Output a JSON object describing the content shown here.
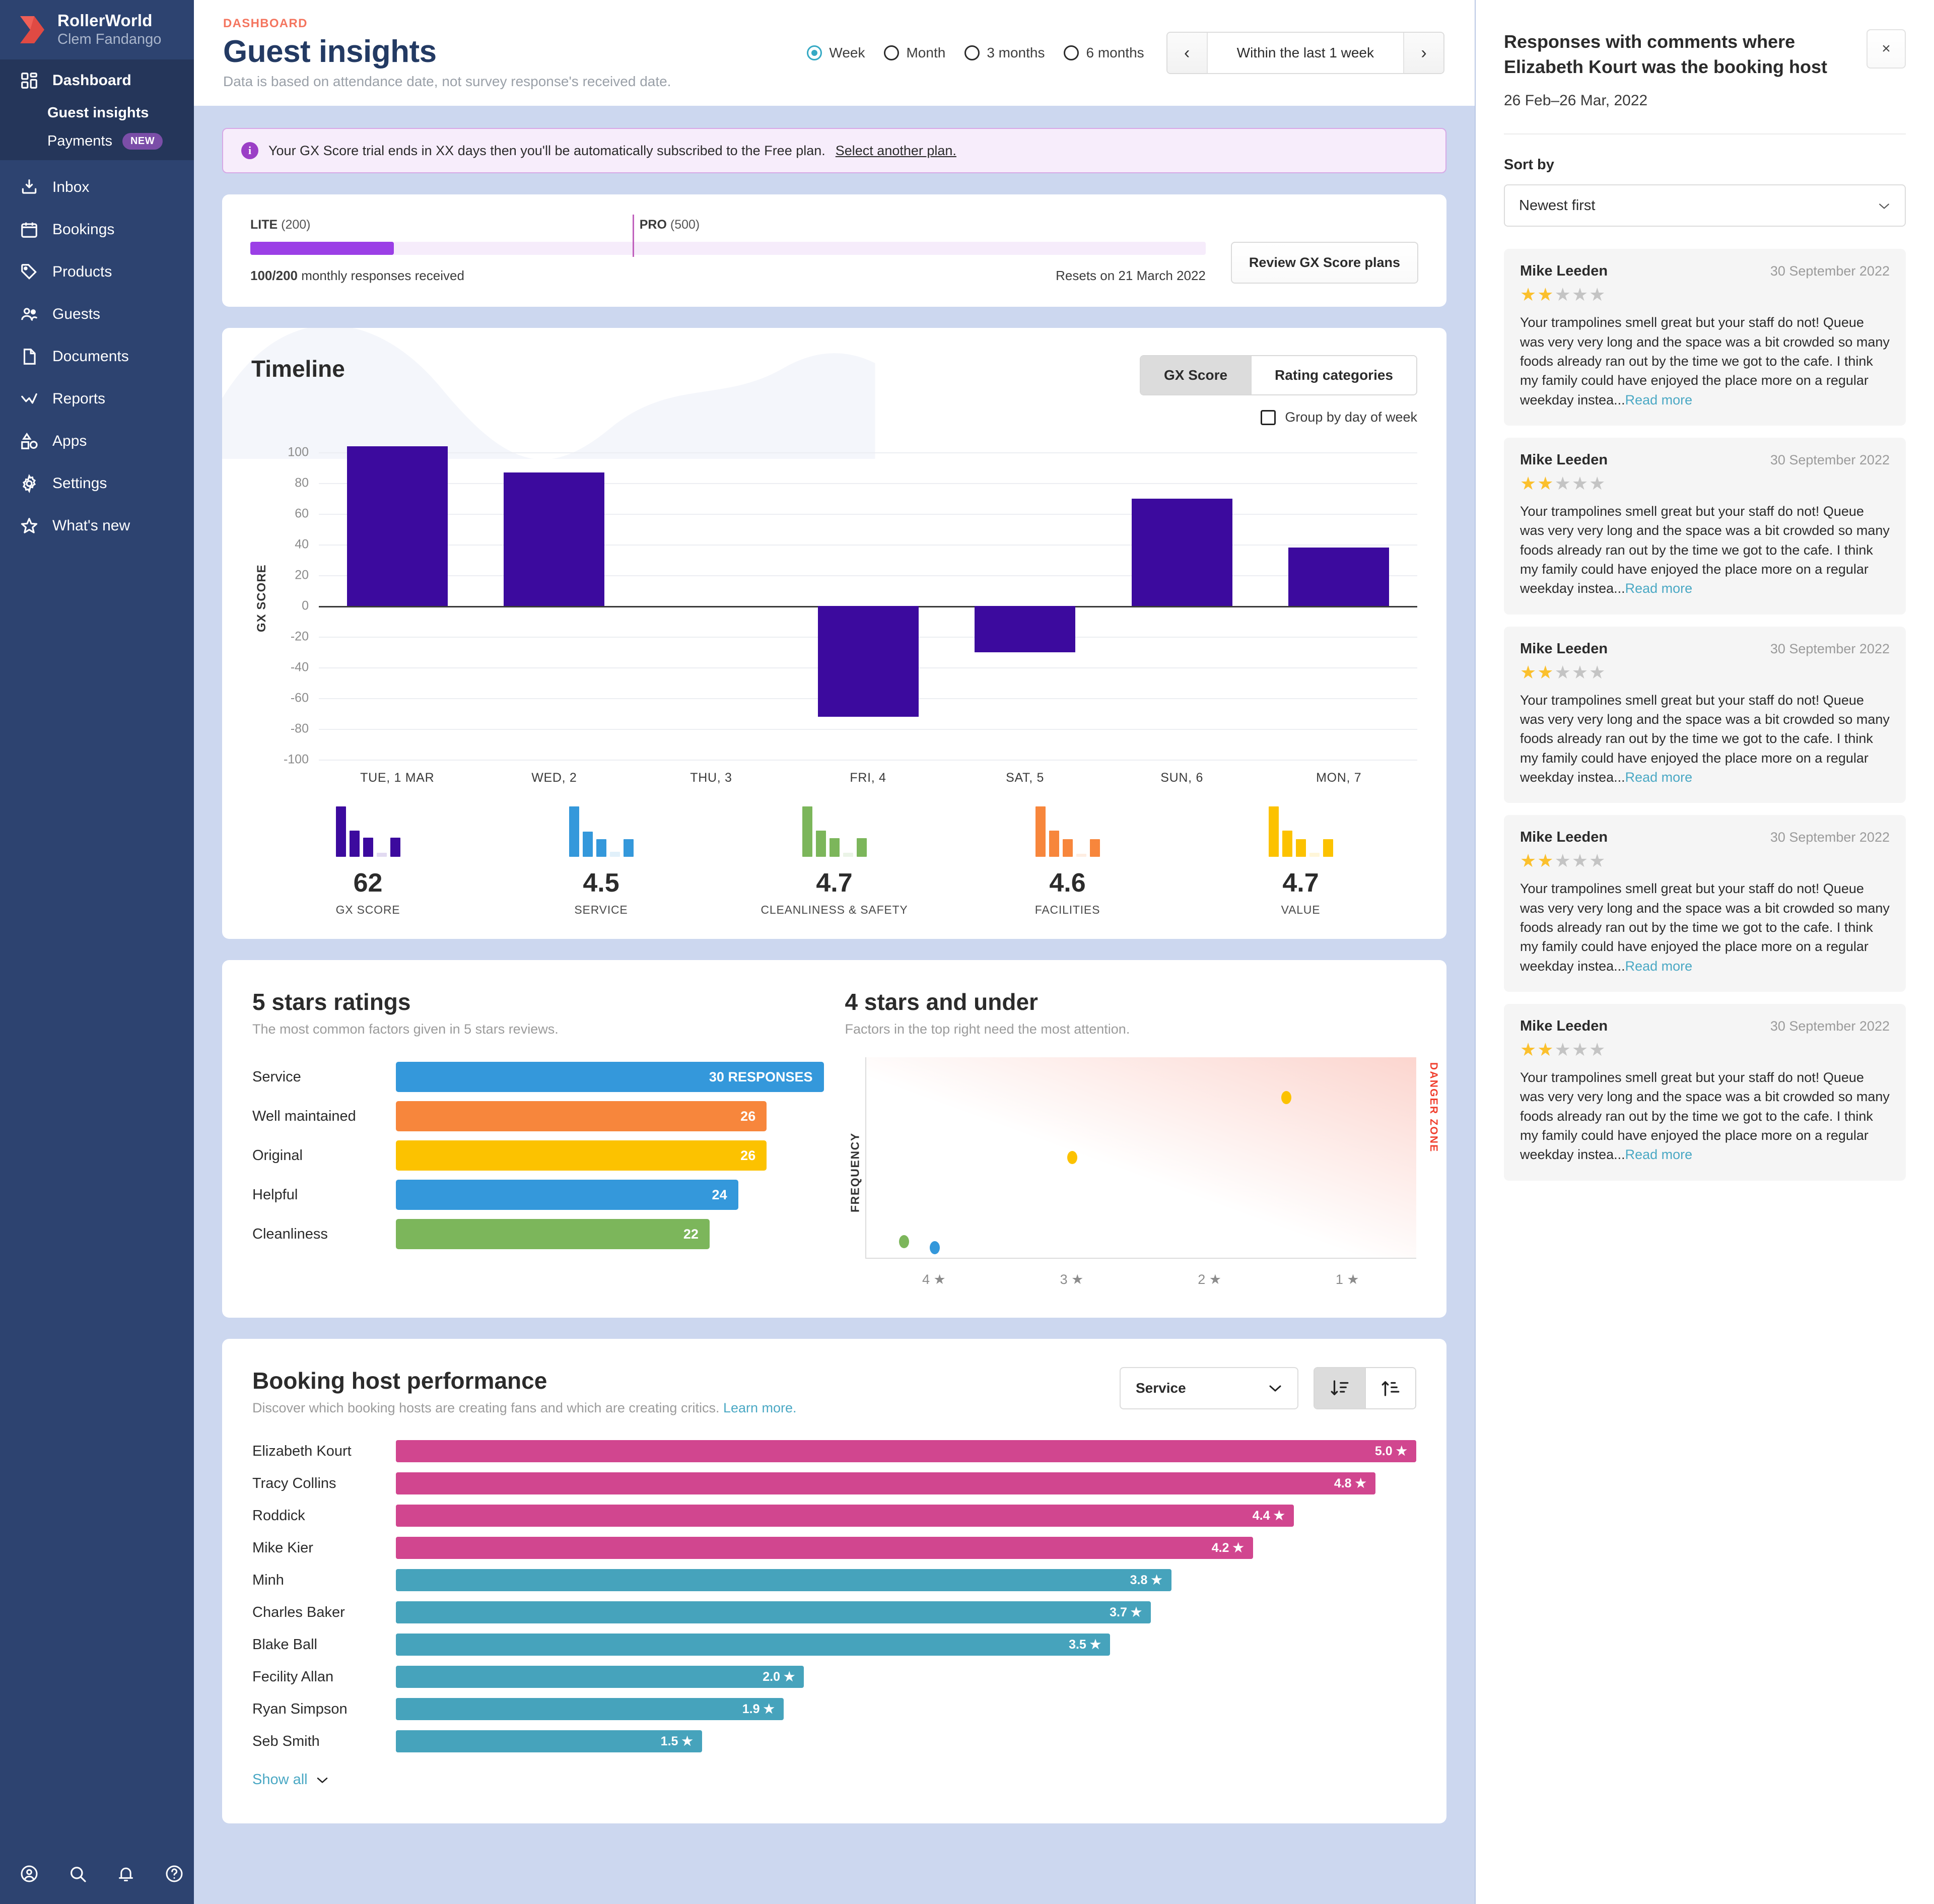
{
  "brand": {
    "name": "RollerWorld",
    "user": "Clem Fandango"
  },
  "sidebar": {
    "primary": [
      {
        "label": "Dashboard",
        "icon": "grid-icon"
      }
    ],
    "sub": [
      {
        "label": "Guest insights",
        "current": true
      },
      {
        "label": "Payments",
        "badge": "NEW"
      }
    ],
    "items": [
      {
        "label": "Inbox",
        "icon": "inbox-icon"
      },
      {
        "label": "Bookings",
        "icon": "calendar-icon"
      },
      {
        "label": "Products",
        "icon": "tag-icon"
      },
      {
        "label": "Guests",
        "icon": "people-icon"
      },
      {
        "label": "Documents",
        "icon": "document-icon"
      },
      {
        "label": "Reports",
        "icon": "chart-line-icon"
      },
      {
        "label": "Apps",
        "icon": "apps-icon"
      },
      {
        "label": "Settings",
        "icon": "gear-icon"
      },
      {
        "label": "What's new",
        "icon": "star-icon"
      }
    ],
    "footer_icons": [
      "account-icon",
      "search-icon",
      "bell-icon",
      "help-icon"
    ]
  },
  "header": {
    "eyebrow": "DASHBOARD",
    "title": "Guest insights",
    "subtitle": "Data is based on attendance date, not survey response's received date.",
    "range_options": [
      {
        "label": "Week",
        "selected": true
      },
      {
        "label": "Month",
        "selected": false
      },
      {
        "label": "3 months",
        "selected": false
      },
      {
        "label": "6 months",
        "selected": false
      }
    ],
    "date_nav": {
      "prev": "‹",
      "value": "Within the last 1 week",
      "next": "›"
    }
  },
  "alert": {
    "icon": "info-icon",
    "text": "Your GX Score trial ends in XX days then you'll be automatically subscribed to the Free plan.",
    "link": "Select another plan."
  },
  "plan": {
    "lite_label": "LITE",
    "lite_value": "(200)",
    "pro_label": "PRO",
    "pro_value": "(500)",
    "progress_pct": 15,
    "marker_pct": 40,
    "responses": "100/200",
    "responses_suffix": " monthly responses received",
    "resets": "Resets on 21 March 2022",
    "review_button": "Review GX Score plans"
  },
  "timeline": {
    "title": "Timeline",
    "tabs": [
      {
        "label": "GX Score",
        "selected": true
      },
      {
        "label": "Rating categories",
        "selected": false
      }
    ],
    "group_by": {
      "label": "Group by day of week",
      "checked": false
    },
    "stats": [
      {
        "value": "62",
        "label": "GX SCORE",
        "color": "#3c0a9e",
        "spark": [
          100,
          52,
          38,
          8,
          38
        ]
      },
      {
        "value": "4.5",
        "label": "SERVICE",
        "color": "#3498db",
        "spark": [
          100,
          50,
          35,
          10,
          35
        ]
      },
      {
        "value": "4.7",
        "label": "CLEANLINESS & SAFETY",
        "color": "#7cb65b",
        "spark": [
          100,
          52,
          37,
          8,
          37
        ]
      },
      {
        "value": "4.6",
        "label": "FACILITIES",
        "color": "#f7863c",
        "spark": [
          100,
          52,
          35,
          6,
          35
        ]
      },
      {
        "value": "4.7",
        "label": "VALUE",
        "color": "#fcc200",
        "spark": [
          100,
          52,
          35,
          8,
          35
        ]
      }
    ]
  },
  "chart_data": [
    {
      "type": "bar",
      "title": "Timeline",
      "xlabel": "",
      "ylabel": "GX SCORE",
      "ylim": [
        -100,
        110
      ],
      "yticks": [
        100,
        80,
        60,
        40,
        20,
        0,
        -20,
        -40,
        -60,
        -80,
        -100
      ],
      "grid": true,
      "bar_color": "#3c0a9e",
      "categories": [
        "TUE, 1 MAR",
        "WED, 2",
        "THU, 3",
        "FRI, 4",
        "SAT, 5",
        "SUN, 6",
        "MON, 7"
      ],
      "values": [
        104,
        87,
        0,
        -72,
        -30,
        70,
        38
      ]
    },
    {
      "type": "bar",
      "title": "5 stars ratings",
      "subtitle": "The most common factors given in 5 stars reviews.",
      "orientation": "horizontal",
      "xlabel": "",
      "ylabel": "",
      "categories": [
        "Service",
        "Well maintained",
        "Original",
        "Helpful",
        "Cleanliness"
      ],
      "values": [
        30,
        26,
        26,
        24,
        22
      ],
      "value_labels": [
        "30 RESPONSES",
        "26",
        "26",
        "24",
        "22"
      ],
      "colors": [
        "#3498db",
        "#f7863c",
        "#fcc200",
        "#3498db",
        "#7cb65b"
      ]
    },
    {
      "type": "scatter",
      "title": "4 stars and under",
      "subtitle": "Factors in the top right need the most attention.",
      "xlabel": "",
      "ylabel": "FREQUENCY",
      "xtick_labels": [
        "4 ★",
        "3 ★",
        "2 ★",
        "1 ★"
      ],
      "annotation": "DANGER ZONE",
      "points": [
        {
          "x": 4.0,
          "y": 0.08,
          "color": "#7cb65b"
        },
        {
          "x": 3.8,
          "y": 0.05,
          "color": "#3498db"
        },
        {
          "x": 2.9,
          "y": 0.5,
          "color": "#fcc200"
        },
        {
          "x": 1.5,
          "y": 0.8,
          "color": "#fcc200"
        }
      ]
    },
    {
      "type": "bar",
      "title": "Booking host performance",
      "subtitle": "Discover which booking hosts are creating fans and which are creating critics.",
      "orientation": "horizontal",
      "xlabel": "",
      "ylabel": "",
      "xlim": [
        0,
        5
      ],
      "categories": [
        "Elizabeth Kourt",
        "Tracy Collins",
        "Roddick",
        "Mike Kier",
        "Minh",
        "Charles Baker",
        "Blake Ball",
        "Fecility Allan",
        "Ryan Simpson",
        "Seb Smith"
      ],
      "values": [
        5.0,
        4.8,
        4.4,
        4.2,
        3.8,
        3.7,
        3.5,
        2.0,
        1.9,
        1.5
      ],
      "value_labels": [
        "5.0 ★",
        "4.8 ★",
        "4.4 ★",
        "4.2 ★",
        "3.8 ★",
        "3.7 ★",
        "3.5 ★",
        "2.0 ★",
        "1.9 ★",
        "1.5 ★"
      ],
      "colors": [
        "#d1468f",
        "#d1468f",
        "#d1468f",
        "#d1468f",
        "#46a3bc",
        "#46a3bc",
        "#46a3bc",
        "#46a3bc",
        "#46a3bc",
        "#46a3bc"
      ]
    }
  ],
  "five_star": {
    "title": "5 stars ratings",
    "subtitle": "The most common factors given in 5 stars reviews.",
    "rows": [
      {
        "label": "Service",
        "value": 30,
        "display": "30 RESPONSES",
        "color": "#3498db"
      },
      {
        "label": "Well maintained",
        "value": 26,
        "display": "26",
        "color": "#f7863c"
      },
      {
        "label": "Original",
        "value": 26,
        "display": "26",
        "color": "#fcc200"
      },
      {
        "label": "Helpful",
        "value": 24,
        "display": "24",
        "color": "#3498db"
      },
      {
        "label": "Cleanliness",
        "value": 22,
        "display": "22",
        "color": "#7cb65b"
      }
    ]
  },
  "four_star": {
    "title": "4 stars and under",
    "subtitle": "Factors in the top right need the most attention.",
    "ylabel": "FREQUENCY",
    "danger": "DANGER ZONE",
    "xticks": [
      "4 ★",
      "3 ★",
      "2 ★",
      "1 ★"
    ]
  },
  "hosts": {
    "title": "Booking host performance",
    "subtitle": "Discover which booking hosts are creating fans and which are creating critics.",
    "link": "Learn more.",
    "filter": "Service",
    "chevron": "⌄",
    "sort_desc_icon": "sort-descending-icon",
    "sort_asc_icon": "sort-ascending-icon",
    "show_all": "Show all",
    "rows": [
      {
        "name": "Elizabeth Kourt",
        "value": 5.0,
        "display": "5.0 ★",
        "color": "#d1468f"
      },
      {
        "name": "Tracy Collins",
        "value": 4.8,
        "display": "4.8 ★",
        "color": "#d1468f"
      },
      {
        "name": "Roddick",
        "value": 4.4,
        "display": "4.4 ★",
        "color": "#d1468f"
      },
      {
        "name": "Mike Kier",
        "value": 4.2,
        "display": "4.2 ★",
        "color": "#d1468f"
      },
      {
        "name": "Minh",
        "value": 3.8,
        "display": "3.8 ★",
        "color": "#46a3bc"
      },
      {
        "name": "Charles Baker",
        "value": 3.7,
        "display": "3.7 ★",
        "color": "#46a3bc"
      },
      {
        "name": "Blake Ball",
        "value": 3.5,
        "display": "3.5 ★",
        "color": "#46a3bc"
      },
      {
        "name": "Fecility Allan",
        "value": 2.0,
        "display": "2.0 ★",
        "color": "#46a3bc"
      },
      {
        "name": "Ryan Simpson",
        "value": 1.9,
        "display": "1.9 ★",
        "color": "#46a3bc"
      },
      {
        "name": "Seb Smith",
        "value": 1.5,
        "display": "1.5 ★",
        "color": "#46a3bc"
      }
    ]
  },
  "panel": {
    "title": "Responses with comments where Elizabeth Kourt was the booking host",
    "close": "×",
    "date_range": "26 Feb–26 Mar, 2022",
    "sort_label": "Sort by",
    "sort_value": "Newest first",
    "responses": [
      {
        "name": "Mike Leeden",
        "date": "30 September 2022",
        "rating": 2,
        "text": "Your trampolines smell great but your staff do not! Queue was very very long and the space was a bit crowded so many foods already ran out by the time we got to the cafe. I think my family could have enjoyed the place more on a regular weekday instea...",
        "more": "Read more"
      },
      {
        "name": "Mike Leeden",
        "date": "30 September 2022",
        "rating": 2,
        "text": "Your trampolines smell great but your staff do not! Queue was very very long and the space was a bit crowded so many foods already ran out by the time we got to the cafe. I think my family could have enjoyed the place more on a regular weekday instea...",
        "more": "Read more"
      },
      {
        "name": "Mike Leeden",
        "date": "30 September 2022",
        "rating": 2,
        "text": "Your trampolines smell great but your staff do not! Queue was very very long and the space was a bit crowded so many foods already ran out by the time we got to the cafe. I think my family could have enjoyed the place more on a regular weekday instea...",
        "more": "Read more"
      },
      {
        "name": "Mike Leeden",
        "date": "30 September 2022",
        "rating": 2,
        "text": "Your trampolines smell great but your staff do not! Queue was very very long and the space was a bit crowded so many foods already ran out by the time we got to the cafe. I think my family could have enjoyed the place more on a regular weekday instea...",
        "more": "Read more"
      },
      {
        "name": "Mike Leeden",
        "date": "30 September 2022",
        "rating": 2,
        "text": "Your trampolines smell great but your staff do not! Queue was very very long and the space was a bit crowded so many foods already ran out by the time we got to the cafe. I think my family could have enjoyed the place more on a regular weekday instea...",
        "more": "Read more"
      }
    ]
  },
  "colors": {
    "sidebar": "#2d4370",
    "sidebar_active": "#25365a",
    "accent_orange": "#f4755f",
    "title_navy": "#233a63",
    "bar_purple": "#3c0a9e",
    "page_bg": "#ccd7ef",
    "link": "#4aa8c4"
  }
}
